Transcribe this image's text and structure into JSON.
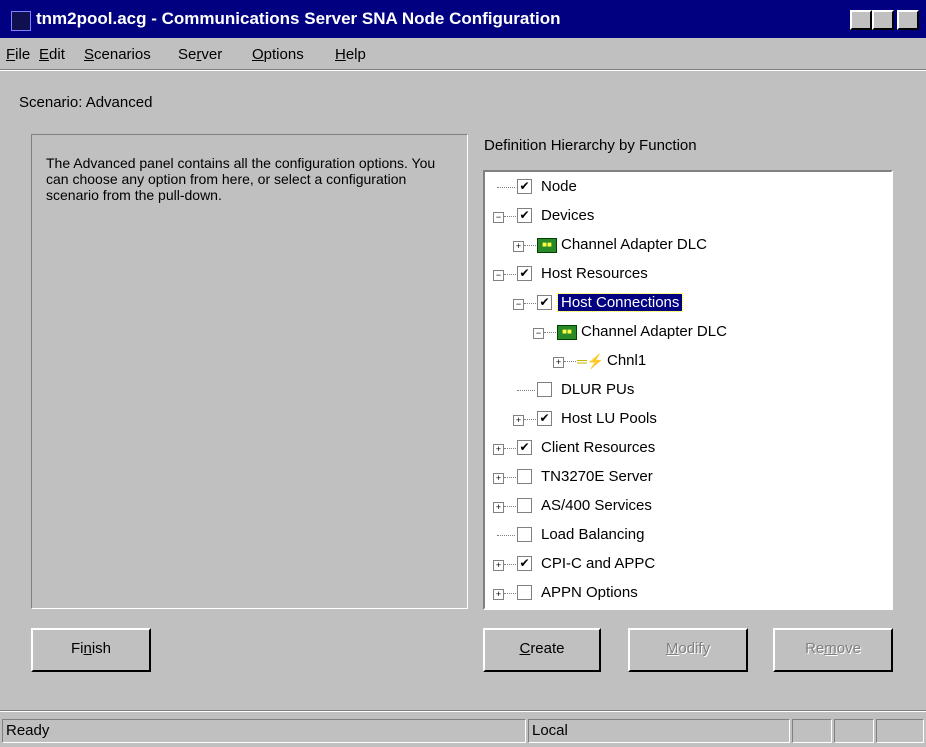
{
  "window": {
    "title": "tnm2pool.acg - Communications Server SNA Node Configuration"
  },
  "menu": [
    {
      "label": "File",
      "u": "F",
      "rest": "ile"
    },
    {
      "label": "Edit",
      "u": "E",
      "rest": "dit"
    },
    {
      "label": "Scenarios",
      "u": "S",
      "rest": "cenarios"
    },
    {
      "label": "Server",
      "pre": "Se",
      "u": "r",
      "rest": "ver"
    },
    {
      "label": "Options",
      "u": "O",
      "rest": "ptions"
    },
    {
      "label": "Help",
      "u": "H",
      "rest": "elp"
    }
  ],
  "scenario": {
    "label": "Scenario: Advanced"
  },
  "description": "The Advanced panel contains all the configuration options. You can choose any option from here, or select a configuration scenario from the pull-down.",
  "hierarchy": {
    "label": "Definition Hierarchy by Function",
    "items": [
      {
        "label": "Node",
        "checked": true,
        "expander": "none",
        "level": 0
      },
      {
        "label": "Devices",
        "checked": true,
        "expander": "minus",
        "level": 0
      },
      {
        "label": "Channel Adapter DLC",
        "icon": "dlc-adapter-icon",
        "expander": "plus",
        "level": 1
      },
      {
        "label": "Host Resources",
        "checked": true,
        "expander": "minus",
        "level": 0
      },
      {
        "label": "Host Connections",
        "checked": true,
        "expander": "minus",
        "level": 1,
        "selected": true
      },
      {
        "label": "Channel Adapter DLC",
        "icon": "dlc-adapter-icon",
        "expander": "minus",
        "level": 2
      },
      {
        "label": "Chnl1",
        "icon": "channel-link-icon",
        "expander": "plus",
        "level": 3
      },
      {
        "label": "DLUR PUs",
        "checked": false,
        "expander": "none",
        "level": 1
      },
      {
        "label": "Host LU Pools",
        "checked": true,
        "expander": "plus",
        "level": 1
      },
      {
        "label": "Client Resources",
        "checked": true,
        "expander": "plus",
        "level": 0
      },
      {
        "label": "TN3270E Server",
        "checked": false,
        "expander": "plus",
        "level": 0
      },
      {
        "label": "AS/400 Services",
        "checked": false,
        "expander": "plus",
        "level": 0
      },
      {
        "label": "Load Balancing",
        "checked": false,
        "expander": "none",
        "level": 0
      },
      {
        "label": "CPI-C and APPC",
        "checked": true,
        "expander": "plus",
        "level": 0
      },
      {
        "label": "APPN Options",
        "checked": false,
        "expander": "plus",
        "level": 0
      }
    ]
  },
  "buttons": {
    "finish": {
      "pre": "Fi",
      "u": "n",
      "rest": "ish"
    },
    "create": {
      "pre": "",
      "u": "C",
      "rest": "reate"
    },
    "modify": {
      "pre": "",
      "u": "M",
      "rest": "odify"
    },
    "remove": {
      "pre": "Re",
      "u": "m",
      "rest": "ove"
    }
  },
  "status": {
    "left": "Ready",
    "right": "Local"
  },
  "colors": {
    "titlebar": "#000080",
    "face": "#c0c0c0",
    "selection": "#000080"
  }
}
